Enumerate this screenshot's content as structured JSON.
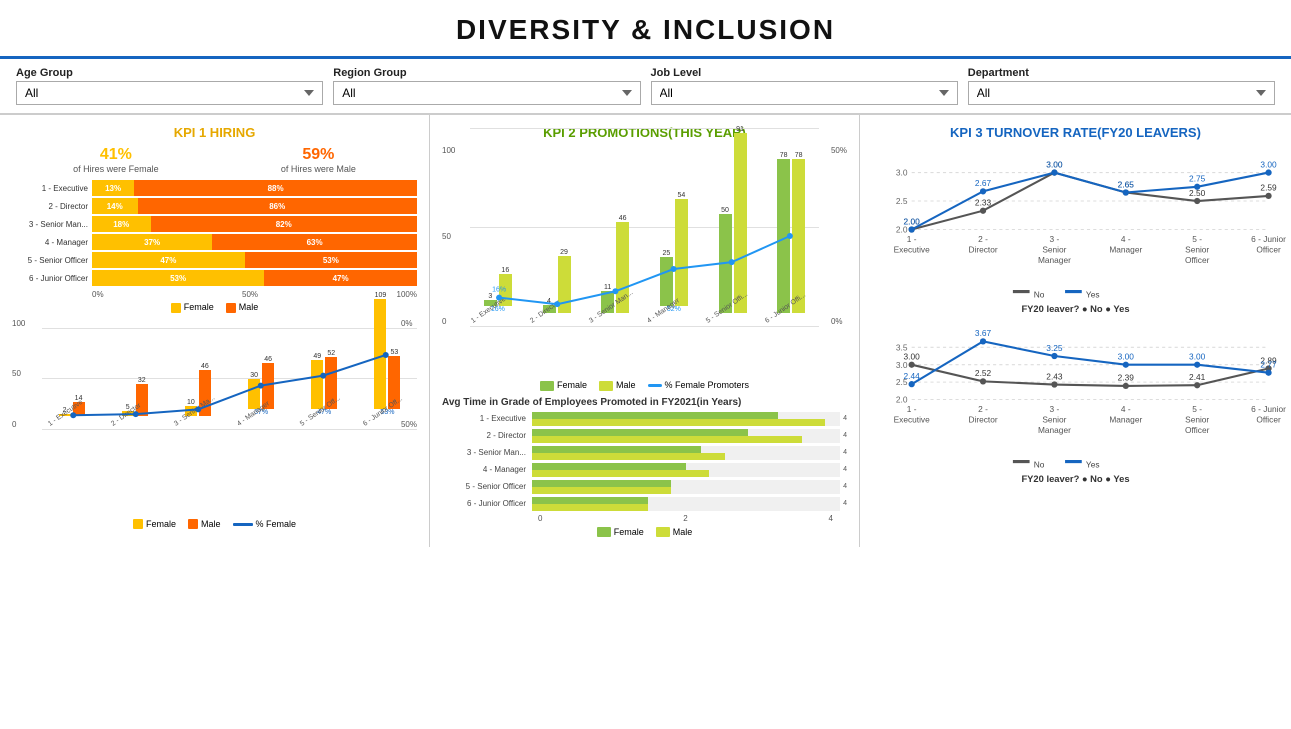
{
  "title": "DIVERSITY & INCLUSION",
  "filters": [
    {
      "label": "Age Group",
      "value": "All"
    },
    {
      "label": "Region Group",
      "value": "All"
    },
    {
      "label": "Job Level",
      "value": "All"
    },
    {
      "label": "Department",
      "value": "All"
    }
  ],
  "kpi1": {
    "title": "KPI 1 HIRING",
    "female_pct": "41%",
    "female_desc": "of Hires were Female",
    "male_pct": "59%",
    "male_desc": "of Hires were Male",
    "bars": [
      {
        "label": "1 - Executive",
        "female": 13,
        "male": 88
      },
      {
        "label": "2 - Director",
        "female": 14,
        "male": 86
      },
      {
        "label": "3 - Senior Man...",
        "female": 18,
        "male": 82
      },
      {
        "label": "4 - Manager",
        "female": 37,
        "male": 63
      },
      {
        "label": "5 - Senior Officer",
        "female": 47,
        "male": 53
      },
      {
        "label": "6 - Junior Officer",
        "female": 53,
        "male": 47
      }
    ],
    "legend": {
      "female": "Female",
      "male": "Male"
    },
    "bottom_bars": [
      {
        "label": "1 - Executive",
        "female_val": 2,
        "male_val": 14,
        "pct": ""
      },
      {
        "label": "2 - Director",
        "female_val": 5,
        "male_val": 32,
        "pct": ""
      },
      {
        "label": "3 - Senior Ma...",
        "female_val": 10,
        "male_val": 46,
        "pct": ""
      },
      {
        "label": "4 - Manager",
        "female_val": 30,
        "male_val": 46,
        "pct": "37%"
      },
      {
        "label": "5 - Senior Off...",
        "female_val": 49,
        "male_val": 52,
        "pct": "47%"
      },
      {
        "label": "6 - Junior Off...",
        "female_val": 109,
        "male_val": 53,
        "pct": "53%"
      }
    ],
    "bottom_legend": {
      "female": "Female",
      "male": "Male",
      "pct": "% Female"
    }
  },
  "kpi2": {
    "title": "KPI 2 PROMOTIONS(THIS YEAR)",
    "promo_bars": [
      {
        "label": "1 - Executive",
        "female": 3,
        "male": 16,
        "pct": 16
      },
      {
        "label": "2 - Director",
        "female": 4,
        "male": 29,
        "pct": null
      },
      {
        "label": "3 - Senior Man...",
        "female": 11,
        "male": 46,
        "pct": null
      },
      {
        "label": "4 - Manager",
        "female": 25,
        "male": 54,
        "pct": 52
      },
      {
        "label": "5 - Senior Offi...",
        "female": 50,
        "male": 91,
        "pct": null
      },
      {
        "label": "6 - Junior Offi...",
        "female": 78,
        "male": 78,
        "pct": null
      }
    ],
    "avg_title": "Avg Time in Grade of Employees Promoted in FY2021(in Years)",
    "avg_bars": [
      {
        "label": "1 - Executive",
        "female": 3.2,
        "male": 3.8
      },
      {
        "label": "2 - Director",
        "female": 2.8,
        "male": 3.5
      },
      {
        "label": "3 - Senior Man...",
        "female": 2.2,
        "male": 2.5
      },
      {
        "label": "4 - Manager",
        "female": 2.0,
        "male": 2.3
      },
      {
        "label": "5 - Senior Officer",
        "female": 1.8,
        "male": 1.8
      },
      {
        "label": "6 - Junior Officer",
        "female": 1.5,
        "male": 1.5
      }
    ],
    "legend": {
      "female": "Female",
      "male": "Male"
    }
  },
  "kpi3": {
    "title": "KPI 3 TURNOVER RATE(FY20 LEAVERS)",
    "chart1": {
      "title": "FY20 leaver?",
      "labels": [
        "1 -\nExecutive",
        "2 -\nDirector",
        "3 -\nSenior\nManager",
        "4 -\nManager",
        "5 -\nSenior\nOfficer",
        "6 - Junior\nOfficer"
      ],
      "no_vals": [
        2.0,
        2.33,
        3.0,
        2.65,
        2.5,
        2.59
      ],
      "yes_vals": [
        2.0,
        2.67,
        3.0,
        2.65,
        2.75,
        3.0
      ],
      "legend_no": "No",
      "legend_yes": "Yes"
    },
    "chart2": {
      "title": "FY20 leaver?",
      "labels": [
        "1 -\nExecutive",
        "2 -\nDirector",
        "3 -\nSenior\nManager",
        "4 -\nManager",
        "5 -\nSenior\nOfficer",
        "6 - Junior\nOfficer"
      ],
      "no_vals": [
        3.0,
        2.52,
        2.43,
        2.39,
        2.41,
        2.89
      ],
      "yes_vals": [
        2.44,
        3.67,
        3.25,
        3.0,
        3.0,
        2.77
      ],
      "legend_no": "No",
      "legend_yes": "Yes"
    }
  }
}
